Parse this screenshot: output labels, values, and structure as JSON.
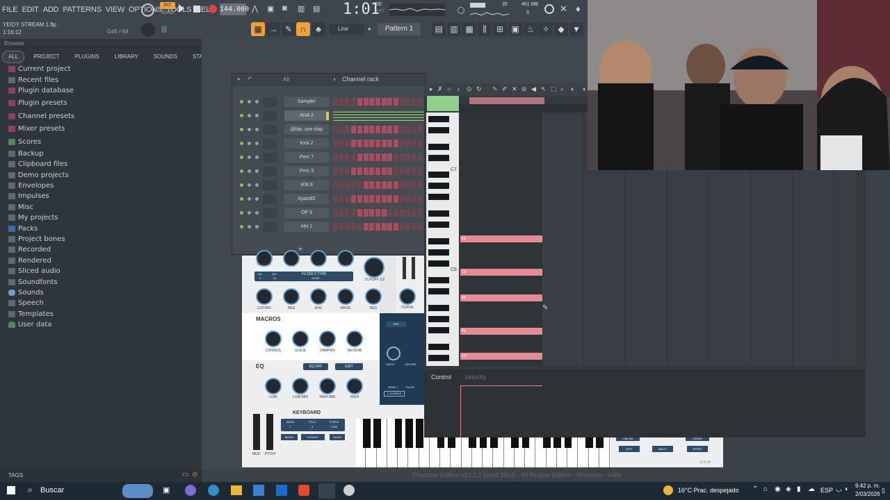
{
  "menu": [
    "FILE",
    "EDIT",
    "ADD",
    "PATTERNS",
    "VIEW",
    "OPTIONS",
    "TOOLS",
    "HELP"
  ],
  "transport": {
    "pat_label": "PAT",
    "song_label": "SONG",
    "tempo": "144.000",
    "time": "1:01",
    "time_sub": "00",
    "time_unit": "B:S:T",
    "mem": "461 MB",
    "cpu_value": "35",
    "voices": "5"
  },
  "project": {
    "file": "YEIDY STREAM 1.flp",
    "position": "1:16:12",
    "note_info": "G#5 / 68"
  },
  "toolbar": {
    "line_label": "Line",
    "pattern": "Pattern 1"
  },
  "browser": {
    "title": "Browser",
    "tabs": [
      "ALL",
      "PROJECT",
      "PLUGINS",
      "LIBRARY",
      "SOUNDS",
      "STARRED"
    ],
    "items": [
      "Current project",
      "Recent files",
      "Plugin database",
      "Plugin presets",
      "Channel presets",
      "Mixer presets",
      "Scores",
      "Backup",
      "Clipboard files",
      "Demo projects",
      "Envelopes",
      "Impulses",
      "Misc",
      "My projects",
      "Packs",
      "Project bones",
      "Recorded",
      "Rendered",
      "Sliced audio",
      "Soundfonts",
      "Sounds",
      "Speech",
      "Templates",
      "User data"
    ],
    "tags_label": "TAGS"
  },
  "rack": {
    "title": "Channel rack",
    "filter": "All",
    "channels": [
      "Sampler",
      "ANA 2",
      "@blp..use clap",
      "Kick 2",
      "Perc 7",
      "Perc 3",
      "808 9",
      "Xpandl2",
      "OP 3",
      "HH 1"
    ],
    "add": "+"
  },
  "synth": {
    "macros": "MACROS",
    "eq": "EQ",
    "eq_off": "EQ OFF",
    "edit": "EDIT",
    "keyboard": "KEYBOARD",
    "filter2": "FILTER 2 TYPE",
    "filter2_val": "NONE",
    "cutoff12": "CUTOFF 1/2",
    "knobs1": [
      "CUTOFF",
      "RES",
      "ENV",
      "DRIVE"
    ],
    "knobs2": [
      "CUTOFF",
      "RES",
      "ENV",
      "DRIVE",
      "RES",
      "CURVE"
    ],
    "macro_knobs": [
      "CHORUS",
      "LESLIE",
      "DAMPEN",
      "REVERB"
    ],
    "eq_knobs": [
      "LOW",
      "LOW MID",
      "HIGH MID",
      "HIGH"
    ],
    "kb_params": [
      "BEND",
      "POLY",
      "PORTA"
    ],
    "kb_vals": [
      "2",
      "8",
      "0 MS"
    ],
    "kb_btns": [
      "MONO",
      "LEGATO",
      "SLIDE"
    ],
    "mod": "MOD",
    "pitch": "PITCH",
    "vel": "VEL",
    "key": "KEY",
    "vel_val": "0",
    "key_val": "51",
    "send": "SEND 1",
    "plate": "PLATE",
    "chorus": "1 CHORUS",
    "input": "INPUT",
    "dry": "DRY/WE",
    "raf": "RAF",
    "right_btns": [
      "EDIT",
      "MULTI",
      "RESET"
    ],
    "learn": "LEARN",
    "land": "LND UN",
    "version": "v2.6.96"
  },
  "proll": {
    "c7": "C7",
    "c6": "C6",
    "control": "Control",
    "velocity": "Velocity",
    "notes": [
      "E6",
      "C6",
      "A5",
      "F5",
      "D5"
    ]
  },
  "status": {
    "producer": "Producer Edition v21.2.2 [build 3914] - All Plugins Edition - Windows - 64Bit"
  },
  "taskbar": {
    "search": "Buscar",
    "weather": "16°C  Prac. despejado",
    "lang": "ESP",
    "time": "9:42 p. m.",
    "date": "2/03/2026"
  }
}
